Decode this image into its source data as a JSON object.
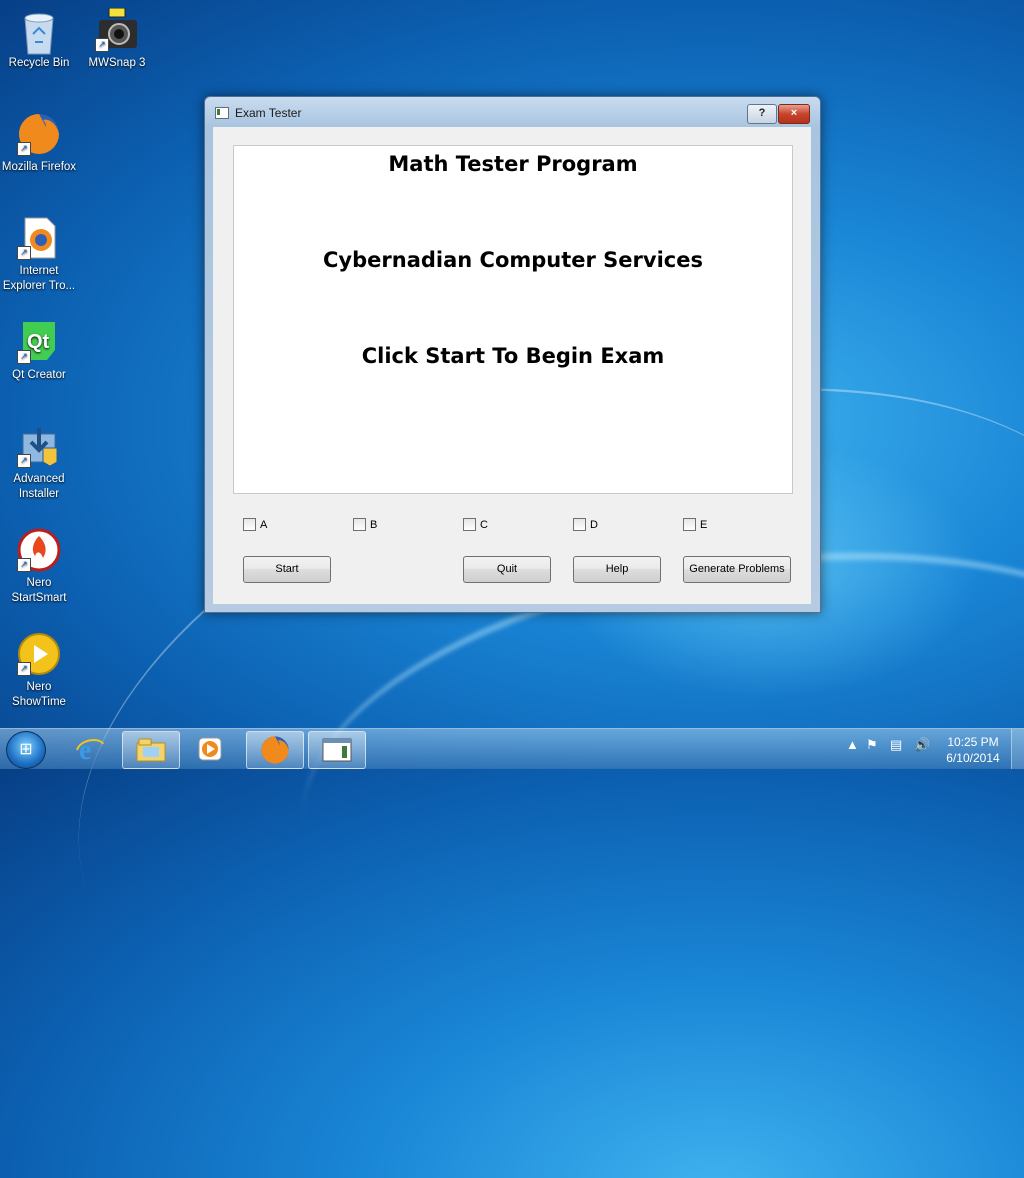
{
  "desktop": {
    "icons": [
      {
        "label": "Recycle Bin",
        "icon": "recycle-bin-icon"
      },
      {
        "label": "MWSnap 3",
        "icon": "camera-icon"
      },
      {
        "label": "Mozilla Firefox",
        "icon": "firefox-icon"
      },
      {
        "label": "Internet Explorer Tro...",
        "icon": "document-firefox-icon"
      },
      {
        "label": "Qt Creator",
        "icon": "qt-icon"
      },
      {
        "label": "Advanced Installer",
        "icon": "installer-icon"
      },
      {
        "label": "Nero StartSmart",
        "icon": "nero-flame-icon"
      },
      {
        "label": "Nero ShowTime",
        "icon": "nero-play-icon"
      }
    ]
  },
  "window": {
    "title": "Exam Tester",
    "help_button": "?",
    "close_button": "×",
    "display": {
      "line1": "Math Tester Program",
      "line2": "Cybernadian Computer Services",
      "line3": "Click Start To Begin Exam"
    },
    "checkboxes": [
      {
        "label": "A",
        "checked": false
      },
      {
        "label": "B",
        "checked": false
      },
      {
        "label": "C",
        "checked": false
      },
      {
        "label": "D",
        "checked": false
      },
      {
        "label": "E",
        "checked": false
      }
    ],
    "buttons": {
      "start": "Start",
      "quit": "Quit",
      "help": "Help",
      "generate": "Generate Problems"
    }
  },
  "taskbar": {
    "items": [
      "internet-explorer-icon",
      "file-explorer-icon",
      "media-player-icon",
      "firefox-icon",
      "exam-tester-app-icon"
    ],
    "tray": [
      "chevron-up-icon",
      "flag-icon",
      "network-icon",
      "speaker-icon"
    ],
    "time": "10:25 PM",
    "date": "6/10/2014"
  }
}
